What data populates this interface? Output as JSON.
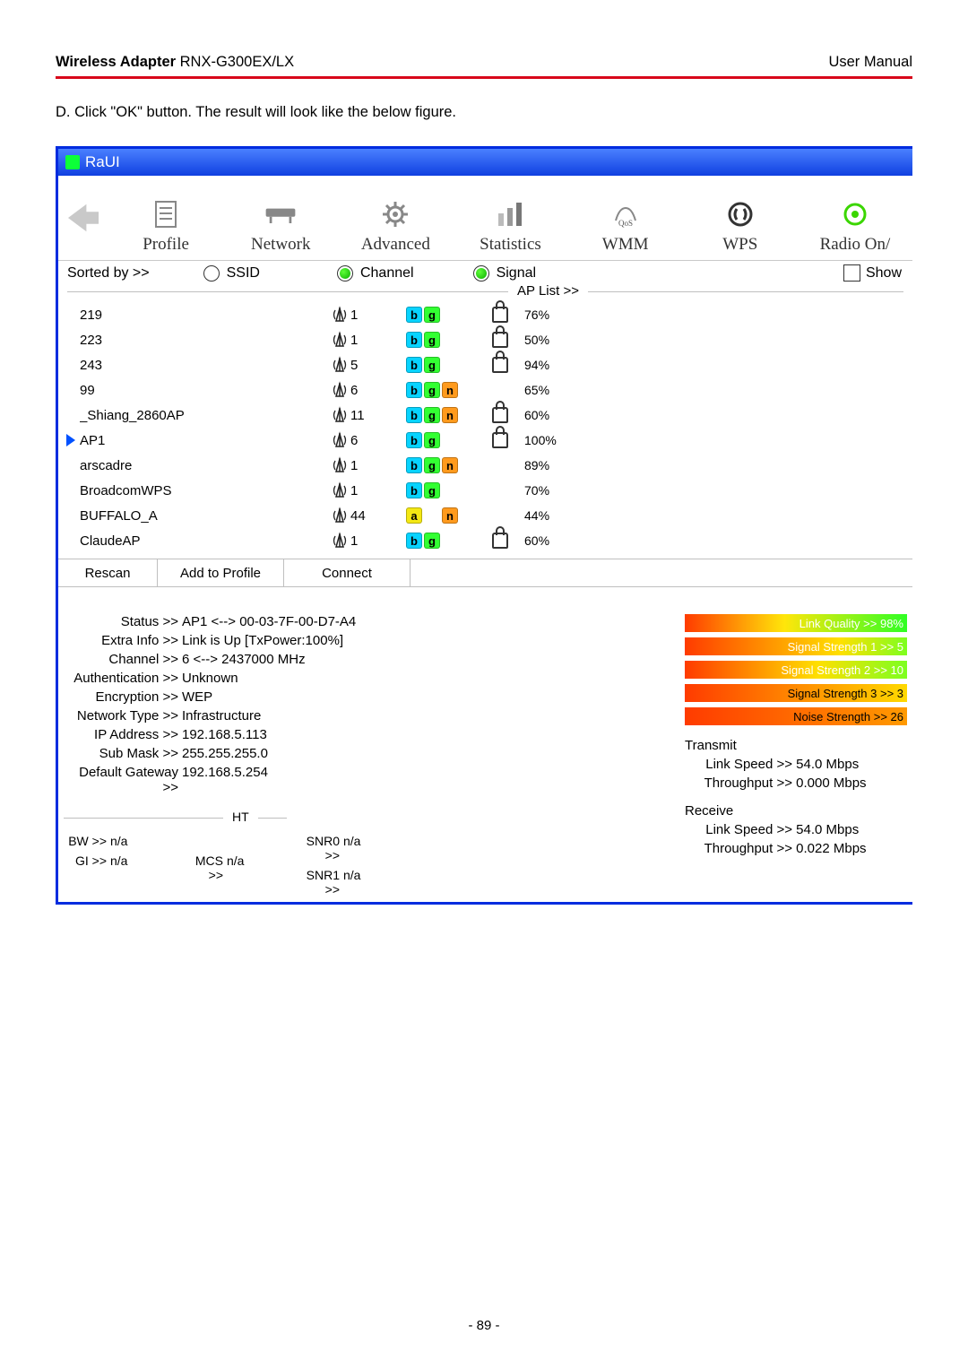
{
  "doc": {
    "header_bold": "Wireless Adapter",
    "header_rest": " RNX-G300EX/LX",
    "header_right": "User Manual",
    "intro": "D. Click \"OK\" button. The result will look like the below figure.",
    "page_num": "- 89 -"
  },
  "app": {
    "title": "RaUI"
  },
  "toolbar": {
    "profile": "Profile",
    "network": "Network",
    "advanced": "Advanced",
    "statistics": "Statistics",
    "wmm": "WMM",
    "wps": "WPS",
    "radio": "Radio On/"
  },
  "sort": {
    "label": "Sorted by >>",
    "ssid": "SSID",
    "channel": "Channel",
    "signal": "Signal",
    "show": "Show"
  },
  "aplist_label": "AP List >>",
  "ap": [
    {
      "ssid": "219",
      "ch": "1",
      "modes": [
        "b",
        "g"
      ],
      "lock": true,
      "pct": "76%",
      "red": 60,
      "yel": 40,
      "sel": false
    },
    {
      "ssid": "223",
      "ch": "1",
      "modes": [
        "b",
        "g"
      ],
      "lock": true,
      "pct": "50%",
      "red": 60,
      "yel": 26,
      "sel": false
    },
    {
      "ssid": "243",
      "ch": "5",
      "modes": [
        "b",
        "g"
      ],
      "lock": true,
      "pct": "94%",
      "red": 60,
      "yel": 40,
      "sel": false
    },
    {
      "ssid": "99",
      "ch": "6",
      "modes": [
        "b",
        "g",
        "n"
      ],
      "lock": false,
      "pct": "65%",
      "red": 60,
      "yel": 40,
      "sel": false
    },
    {
      "ssid": "_Shiang_2860AP",
      "ch": "11",
      "modes": [
        "b",
        "g",
        "n"
      ],
      "lock": true,
      "pct": "60%",
      "red": 60,
      "yel": 40,
      "sel": false
    },
    {
      "ssid": "AP1",
      "ch": "6",
      "modes": [
        "b",
        "g"
      ],
      "lock": true,
      "pct": "100%",
      "red": 60,
      "yel": 40,
      "sel": true
    },
    {
      "ssid": "arscadre",
      "ch": "1",
      "modes": [
        "b",
        "g",
        "n"
      ],
      "lock": false,
      "pct": "89%",
      "red": 60,
      "yel": 40,
      "sel": false
    },
    {
      "ssid": "BroadcomWPS",
      "ch": "1",
      "modes": [
        "b",
        "g"
      ],
      "lock": false,
      "pct": "70%",
      "red": 60,
      "yel": 40,
      "sel": false
    },
    {
      "ssid": "BUFFALO_A",
      "ch": "44",
      "modes": [
        "a",
        "",
        "n"
      ],
      "lock": false,
      "pct": "44%",
      "red": 60,
      "yel": 14,
      "sel": false
    },
    {
      "ssid": "ClaudeAP",
      "ch": "1",
      "modes": [
        "b",
        "g"
      ],
      "lock": true,
      "pct": "60%",
      "red": 60,
      "yel": 40,
      "sel": false
    }
  ],
  "btns": {
    "rescan": "Rescan",
    "add": "Add to Profile",
    "connect": "Connect"
  },
  "status": {
    "rows": [
      {
        "k": "Status >>",
        "v": "AP1 <--> 00-03-7F-00-D7-A4"
      },
      {
        "k": "Extra Info >>",
        "v": "Link is Up [TxPower:100%]"
      },
      {
        "k": "Channel >>",
        "v": "6 <--> 2437000 MHz"
      },
      {
        "k": "Authentication >>",
        "v": "Unknown"
      },
      {
        "k": "Encryption >>",
        "v": "WEP"
      },
      {
        "k": "Network Type >>",
        "v": "Infrastructure"
      },
      {
        "k": "IP Address >>",
        "v": "192.168.5.113"
      },
      {
        "k": "Sub Mask >>",
        "v": "255.255.255.0"
      },
      {
        "k": "Default Gateway >>",
        "v": "192.168.5.254"
      }
    ],
    "quality": [
      "Link Quality >> 98%",
      "Signal Strength 1 >> 5",
      "Signal Strength 2 >> 10",
      "Signal Strength 3 >> 3",
      "Noise Strength >> 26"
    ],
    "tx_title": "Transmit",
    "tx_speed": "54.0 Mbps",
    "tx_thru": "0.000 Mbps",
    "rx_title": "Receive",
    "rx_speed": "54.0 Mbps",
    "rx_thru": "0.022 Mbps",
    "link_speed_lab": "Link Speed >>",
    "thru_lab": "Throughput >>",
    "ht_legend": "HT",
    "ht": {
      "bw_l": "BW >>",
      "bw": "n/a",
      "gi_l": "GI >>",
      "gi": "n/a",
      "mcs_l": "MCS >>",
      "mcs": "n/a",
      "snr0_l": "SNR0 >>",
      "snr0": "n/a",
      "snr1_l": "SNR1 >>",
      "snr1": "n/a"
    }
  }
}
